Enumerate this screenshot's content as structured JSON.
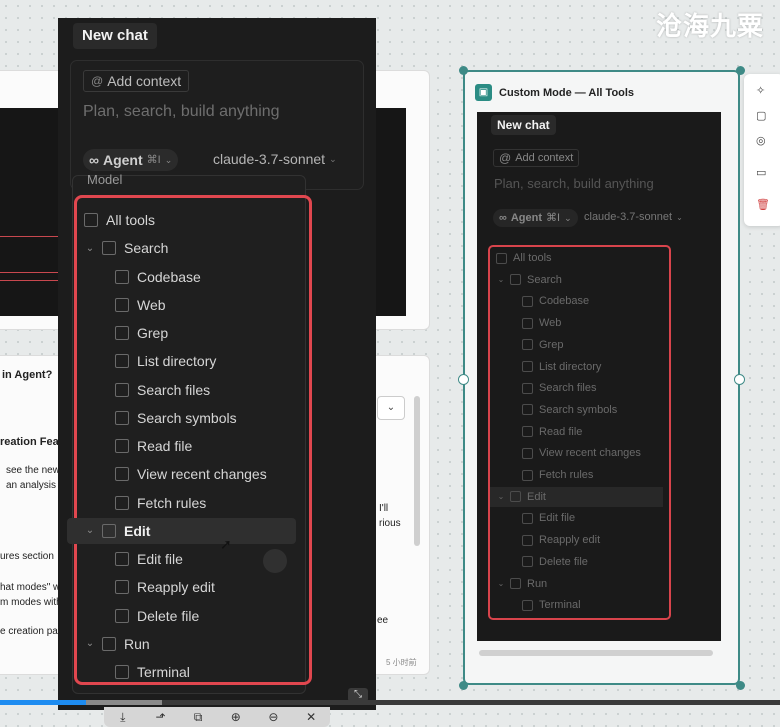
{
  "watermark": "沧海九粟",
  "background": {
    "snippets": [
      {
        "text": "in Agent?",
        "bold": true
      },
      {
        "text": "reation Feat",
        "bold": true
      },
      {
        "text": "see the new"
      },
      {
        "text": "an analysis a"
      },
      {
        "text": "ures section"
      },
      {
        "text": "hat modes\" w"
      },
      {
        "text": "m modes with"
      },
      {
        "text": "e creation pa"
      },
      {
        "text": "I'll"
      },
      {
        "text": "rious"
      },
      {
        "text": "ee"
      },
      {
        "text": "5 小时前"
      }
    ]
  },
  "popup": {
    "new_chat": "New chat",
    "add_context": "Add context",
    "placeholder": "Plan, search, build anything",
    "agent_label": "Agent",
    "agent_shortcut": "⌘I",
    "model": "claude-3.7-sonnet",
    "dropdown_label": "Model",
    "tools": [
      {
        "label": "All tools",
        "level": 0,
        "caret": false
      },
      {
        "label": "Search",
        "level": 0,
        "caret": true
      },
      {
        "label": "Codebase",
        "level": 1
      },
      {
        "label": "Web",
        "level": 1
      },
      {
        "label": "Grep",
        "level": 1
      },
      {
        "label": "List directory",
        "level": 1
      },
      {
        "label": "Search files",
        "level": 1
      },
      {
        "label": "Search symbols",
        "level": 1
      },
      {
        "label": "Read file",
        "level": 1
      },
      {
        "label": "View recent changes",
        "level": 1
      },
      {
        "label": "Fetch rules",
        "level": 1
      },
      {
        "label": "Edit",
        "level": 0,
        "caret": true,
        "highlight": true
      },
      {
        "label": "Edit file",
        "level": 1
      },
      {
        "label": "Reapply edit",
        "level": 1
      },
      {
        "label": "Delete file",
        "level": 1
      },
      {
        "label": "Run",
        "level": 0,
        "caret": true
      },
      {
        "label": "Terminal",
        "level": 1
      }
    ]
  },
  "node": {
    "title": "Custom Mode — All Tools",
    "new_chat": "New chat",
    "add_context": "Add context",
    "placeholder": "Plan, search, build anything",
    "agent_label": "Agent",
    "agent_shortcut": "⌘I",
    "model": "claude-3.7-sonnet"
  },
  "colors": {
    "highlight_border": "#e0474f",
    "node_border": "#3e8a86",
    "progress": "#1e8cf0"
  },
  "toolbar": {
    "buttons": [
      "download-icon",
      "share-icon",
      "copy-icon",
      "zoom-in-icon",
      "zoom-out-icon",
      "close-icon"
    ]
  }
}
